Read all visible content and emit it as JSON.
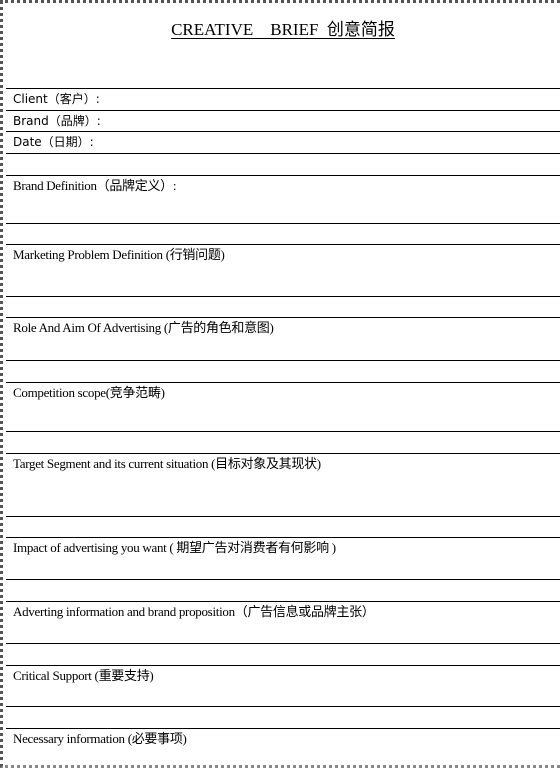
{
  "document": {
    "title": "CREATIVE    BRIEF  创意简报"
  },
  "header_fields": [
    {
      "label": "Client（客户）:",
      "value": ""
    },
    {
      "label": "Brand（品牌）:",
      "value": ""
    },
    {
      "label": "Date（日期）:",
      "value": ""
    }
  ],
  "sections": [
    {
      "label": "Brand Definition（品牌定义）:",
      "value": ""
    },
    {
      "label": "Marketing Problem Definition (行销问题)",
      "value": ""
    },
    {
      "label": "Role And Aim Of Advertising (广告的角色和意图)",
      "value": ""
    },
    {
      "label": "Competition scope(竞争范畴)",
      "value": ""
    },
    {
      "label": "Target Segment and its current situation (目标对象及其现状)",
      "value": ""
    },
    {
      "label": "Impact of advertising you want (  期望广告对消费者有何影响  )",
      "value": ""
    },
    {
      "label": "Adverting information and brand proposition（广告信息或品牌主张）",
      "value": ""
    },
    {
      "label": "Critical Support (重要支持)",
      "value": ""
    },
    {
      "label": "Necessary information (必要事项)",
      "value": ""
    }
  ]
}
